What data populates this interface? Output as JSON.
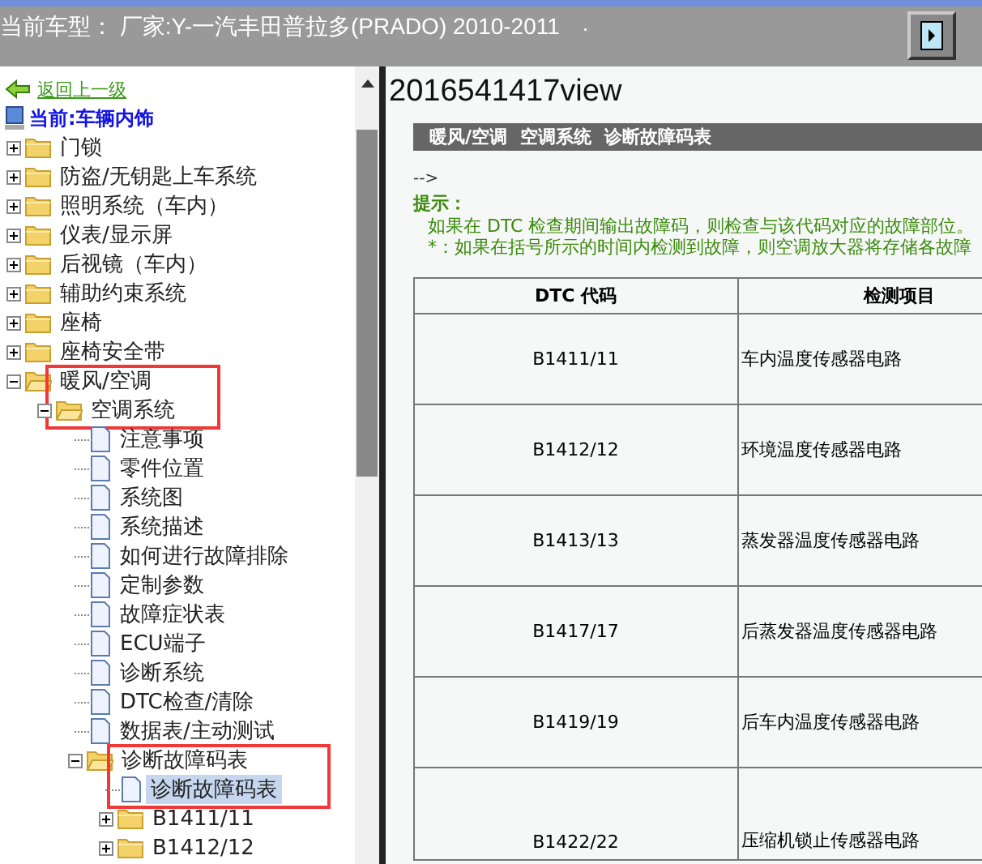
{
  "header": {
    "title": "当前车型：  厂家:Y-一汽丰田普拉多(PRADO) 2010-2011",
    "note": "."
  },
  "sidebar": {
    "back_link": "返回上一级",
    "current": "当前:车辆内饰",
    "tree": [
      {
        "label": "门锁",
        "kind": "folder",
        "expanded": false,
        "selected": false,
        "framed": false
      },
      {
        "label": "防盗/无钥匙上车系统",
        "kind": "folder",
        "expanded": false,
        "selected": false,
        "framed": false
      },
      {
        "label": "照明系统（车内）",
        "kind": "folder",
        "expanded": false,
        "selected": false,
        "framed": false
      },
      {
        "label": "仪表/显示屏",
        "kind": "folder",
        "expanded": false,
        "selected": false,
        "framed": false
      },
      {
        "label": "后视镜（车内）",
        "kind": "folder",
        "expanded": false,
        "selected": false,
        "framed": false
      },
      {
        "label": "辅助约束系统",
        "kind": "folder",
        "expanded": false,
        "selected": false,
        "framed": false
      },
      {
        "label": "座椅",
        "kind": "folder",
        "expanded": false,
        "selected": false,
        "framed": false
      },
      {
        "label": "座椅安全带",
        "kind": "folder",
        "expanded": false,
        "selected": false,
        "framed": false
      },
      {
        "label": "暖风/空调",
        "kind": "folder",
        "expanded": true,
        "selected": false,
        "framed": true,
        "children": [
          {
            "label": "空调系统",
            "kind": "folder",
            "expanded": true,
            "selected": false,
            "framed": false,
            "children": [
              {
                "label": "注意事项",
                "kind": "doc",
                "selected": false,
                "framed": false
              },
              {
                "label": "零件位置",
                "kind": "doc",
                "selected": false,
                "framed": false
              },
              {
                "label": "系统图",
                "kind": "doc",
                "selected": false,
                "framed": false
              },
              {
                "label": "系统描述",
                "kind": "doc",
                "selected": false,
                "framed": false
              },
              {
                "label": "如何进行故障排除",
                "kind": "doc",
                "selected": false,
                "framed": false
              },
              {
                "label": "定制参数",
                "kind": "doc",
                "selected": false,
                "framed": false
              },
              {
                "label": "故障症状表",
                "kind": "doc",
                "selected": false,
                "framed": false
              },
              {
                "label": "ECU端子",
                "kind": "doc",
                "selected": false,
                "framed": false
              },
              {
                "label": "诊断系统",
                "kind": "doc",
                "selected": false,
                "framed": false
              },
              {
                "label": "DTC检查/清除",
                "kind": "doc",
                "selected": false,
                "framed": false
              },
              {
                "label": "数据表/主动测试",
                "kind": "doc",
                "selected": false,
                "framed": false
              },
              {
                "label": "诊断故障码表",
                "kind": "folder",
                "expanded": true,
                "selected": false,
                "framed": true,
                "children": [
                  {
                    "label": "诊断故障码表",
                    "kind": "doc",
                    "selected": true,
                    "framed": false
                  },
                  {
                    "label": "B1411/11",
                    "kind": "folder",
                    "expanded": false,
                    "selected": false,
                    "framed": false
                  },
                  {
                    "label": "B1412/12",
                    "kind": "folder",
                    "expanded": false,
                    "selected": false,
                    "framed": false
                  }
                ]
              }
            ]
          }
        ]
      }
    ]
  },
  "content": {
    "title": "2016541417view",
    "breadcrumb": [
      "暖风/空调",
      "空调系统",
      "诊断故障码表"
    ],
    "comment": "-->",
    "tip_label": "提示：",
    "tip_lines": [
      "如果在 DTC 检查期间输出故障码，则检查与该代码对应的故障部位。",
      "*：如果在括号所示的时间内检测到故障，则空调放大器将存储各故障"
    ],
    "table": {
      "columns": [
        "DTC 代码",
        "检测项目"
      ],
      "rows": [
        {
          "code": "B1411/11",
          "item": "车内温度传感器电路",
          "kind": "normal"
        },
        {
          "code": "B1412/12",
          "item": "环境温度传感器电路",
          "kind": "normal"
        },
        {
          "code": "B1413/13",
          "item": "蒸发器温度传感器电路",
          "kind": "normal"
        },
        {
          "code": "B1417/17",
          "item": "后蒸发器温度传感器电路",
          "kind": "normal"
        },
        {
          "code": "B1419/19",
          "item": "后车内温度传感器电路",
          "kind": "normal"
        },
        {
          "code": "B1422/22",
          "item": "压缩机锁止传感器电路",
          "kind": "tall"
        }
      ]
    }
  }
}
